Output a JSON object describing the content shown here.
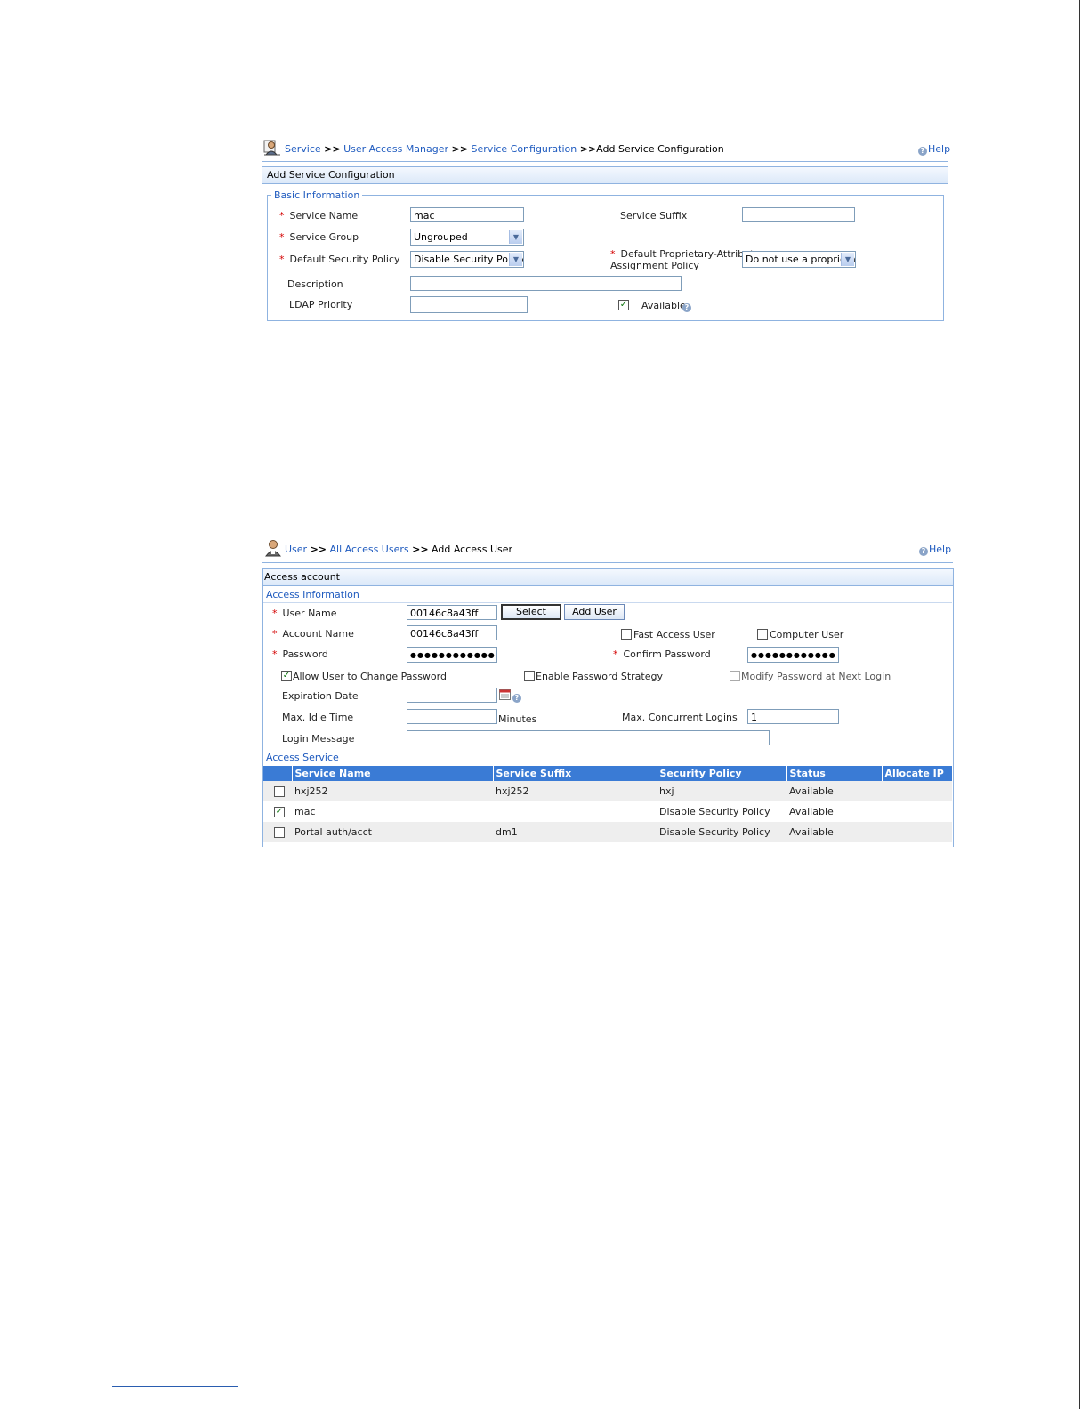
{
  "service_config": {
    "breadcrumb": {
      "items": [
        "Service",
        "User Access Manager",
        "Service Configuration"
      ],
      "separator": ">>",
      "current": "Add Service Configuration"
    },
    "help_label": "Help",
    "panel_title": "Add Service Configuration",
    "section_title": "Basic Information",
    "fields": {
      "service_name_label": "Service Name",
      "service_name_value": "mac",
      "service_suffix_label": "Service Suffix",
      "service_suffix_value": "",
      "service_group_label": "Service Group",
      "service_group_value": "Ungrouped",
      "default_security_policy_label": "Default Security Policy",
      "default_security_policy_value": "Disable Security Policy",
      "proprietary_policy_label_line1": "Default Proprietary-Attribute",
      "proprietary_policy_label_line2": "Assignment Policy",
      "proprietary_policy_value": "Do not use a proprietar",
      "description_label": "Description",
      "description_value": "",
      "ldap_priority_label": "LDAP Priority",
      "ldap_priority_value": "",
      "available_label": "Available",
      "available_checked": true
    },
    "required_mark": "*"
  },
  "access_user": {
    "breadcrumb": {
      "items": [
        "User",
        "All Access Users"
      ],
      "separator": ">>",
      "current": "Add Access User"
    },
    "help_label": "Help",
    "panel_title": "Access account",
    "access_info_title": "Access Information",
    "fields": {
      "user_name_label": "User Name",
      "user_name_value": "00146c8a43ff",
      "select_button": "Select",
      "add_user_button": "Add User",
      "account_name_label": "Account Name",
      "account_name_value": "00146c8a43ff",
      "fast_access_user_label": "Fast Access User",
      "computer_user_label": "Computer User",
      "password_label": "Password",
      "password_value": "●●●●●●●●●●●●●",
      "confirm_password_label": "Confirm Password",
      "confirm_password_value": "●●●●●●●●●●●●",
      "allow_change_password_label": "Allow User to Change Password",
      "allow_change_password_checked": true,
      "enable_password_strategy_label": "Enable Password Strategy",
      "modify_password_next_login_label": "Modify Password at Next Login",
      "expiration_date_label": "Expiration Date",
      "expiration_date_value": "",
      "max_idle_time_label": "Max. Idle Time",
      "max_idle_time_value": "",
      "minutes_label": "Minutes",
      "max_concurrent_logins_label": "Max. Concurrent Logins",
      "max_concurrent_logins_value": "1",
      "login_message_label": "Login Message",
      "login_message_value": ""
    },
    "access_service_title": "Access Service",
    "table": {
      "headers": [
        "Service Name",
        "Service Suffix",
        "Security Policy",
        "Status",
        "Allocate IP"
      ],
      "rows": [
        {
          "checked": false,
          "service_name": "hxj252",
          "service_suffix": "hxj252",
          "security_policy": "hxj",
          "status": "Available",
          "allocate_ip": ""
        },
        {
          "checked": true,
          "service_name": "mac",
          "service_suffix": "",
          "security_policy": "Disable Security Policy",
          "status": "Available",
          "allocate_ip": ""
        },
        {
          "checked": false,
          "service_name": "Portal auth/acct",
          "service_suffix": "dm1",
          "security_policy": "Disable Security Policy",
          "status": "Available",
          "allocate_ip": ""
        }
      ]
    },
    "required_mark": "*"
  },
  "colors": {
    "link": "#1f5bbf",
    "required": "#d40000",
    "table_header": "#3a7bd5",
    "panel_border": "#8fb3e0"
  },
  "icons": [
    "admin-user-icon",
    "help-icon",
    "dropdown-arrow-icon",
    "calendar-icon",
    "checkbox-checked-icon"
  ]
}
